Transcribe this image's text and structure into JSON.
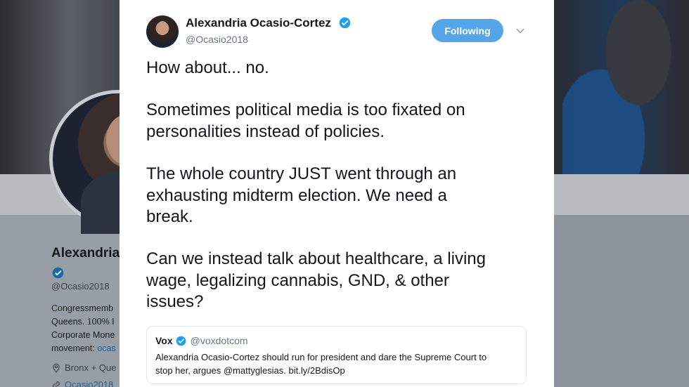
{
  "background": {
    "profile_name": "Alexandria",
    "profile_handle": "@Ocasio2018",
    "bio_lines": [
      "Congressmemb",
      "Queens. 100% I",
      "Corporate Mone",
      "movement: "
    ],
    "bio_link": "ocas",
    "location": "Bronx + Que",
    "website": "Ocasio2018"
  },
  "tweet": {
    "author_name": "Alexandria Ocasio-Cortez",
    "author_handle": "@Ocasio2018",
    "follow_label": "Following",
    "paragraphs": [
      [
        "How about... no."
      ],
      [
        "Sometimes political media is too fixated on",
        "personalities instead of policies."
      ],
      [
        "The whole country JUST went through an",
        "exhausting midterm election. We need a",
        "break."
      ],
      [
        "Can we instead talk about healthcare, a living",
        "wage, legalizing cannabis, GND, & other",
        "issues?"
      ]
    ],
    "quote": {
      "name": "Vox",
      "handle": "@voxdotcom",
      "text_lines": [
        "Alexandria Ocasio-Cortez should run for president and dare the Supreme Court to",
        "stop her, argues @mattyglesias. bit.ly/2BdisOp"
      ]
    }
  },
  "colors": {
    "accent": "#54a6e8",
    "verified": "#1da1f2",
    "secondary_text": "#657786"
  },
  "icons": {
    "verified": "verified-badge-icon",
    "caret": "chevron-down-icon",
    "location": "location-pin-icon",
    "link": "link-icon"
  }
}
